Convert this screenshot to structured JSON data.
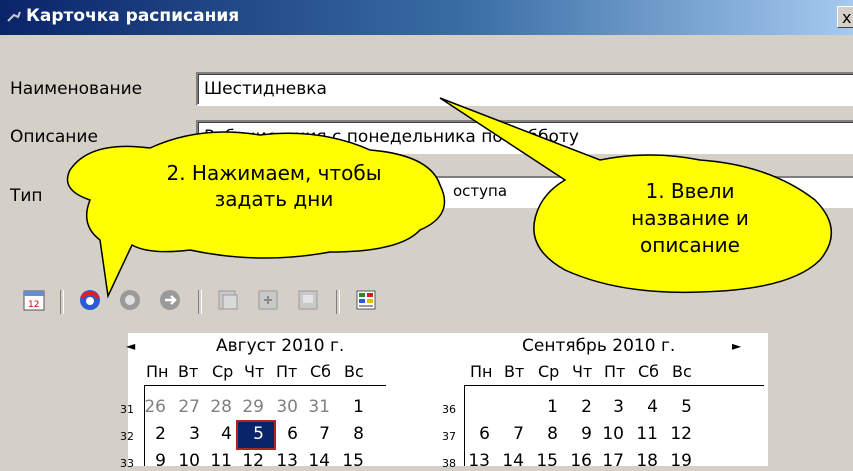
{
  "window": {
    "title": "Карточка расписания",
    "close_label": "x"
  },
  "form": {
    "name_label": "Наименование",
    "name_value": "Шестидневка",
    "desc_label": "Описание",
    "desc_value": "Рабочие дния с понедельника по субботу",
    "type_label": "Тип",
    "access_text": "оступа"
  },
  "toolbar": {
    "icons": [
      "calendar-icon",
      "set-days-icon",
      "clear-icon",
      "reset-icon",
      "copy-icon",
      "paste-icon",
      "print-icon",
      "grid-icon"
    ]
  },
  "calendar": {
    "months": [
      {
        "title": "Август 2010 г.",
        "dow": [
          "Пн",
          "Вт",
          "Ср",
          "Чт",
          "Пт",
          "Сб",
          "Вс"
        ],
        "weeks": [
          {
            "num": "31",
            "days": [
              "26",
              "27",
              "28",
              "29",
              "30",
              "31",
              "1"
            ]
          },
          {
            "num": "32",
            "days": [
              "2",
              "3",
              "4",
              "5",
              "6",
              "7",
              "8"
            ]
          },
          {
            "num": "33",
            "days": [
              "9",
              "10",
              "11",
              "12",
              "13",
              "14",
              "15"
            ]
          }
        ]
      },
      {
        "title": "Сентябрь 2010 г.",
        "dow": [
          "Пн",
          "Вт",
          "Ср",
          "Чт",
          "Пт",
          "Сб",
          "Вс"
        ],
        "weeks": [
          {
            "num": "36",
            "days": [
              "",
              "",
              "1",
              "2",
              "3",
              "4",
              "5"
            ]
          },
          {
            "num": "37",
            "days": [
              "6",
              "7",
              "8",
              "9",
              "10",
              "11",
              "12"
            ]
          },
          {
            "num": "38",
            "days": [
              "13",
              "14",
              "15",
              "16",
              "17",
              "18",
              "19"
            ]
          }
        ]
      }
    ],
    "prev_arrow": "◄",
    "next_arrow": "►",
    "selected_day": "5"
  },
  "callouts": {
    "left": "2. Нажимаем, чтобы задать дни",
    "left_line1": "2. Нажимаем, чтобы",
    "left_line2": "задать дни",
    "right_line1": "1. Ввели",
    "right_line2": "название и",
    "right_line3": "описание"
  },
  "colors": {
    "title_bar": "#0a246a",
    "callout_fill": "#ffff00",
    "selected_day_border": "#b22222"
  }
}
